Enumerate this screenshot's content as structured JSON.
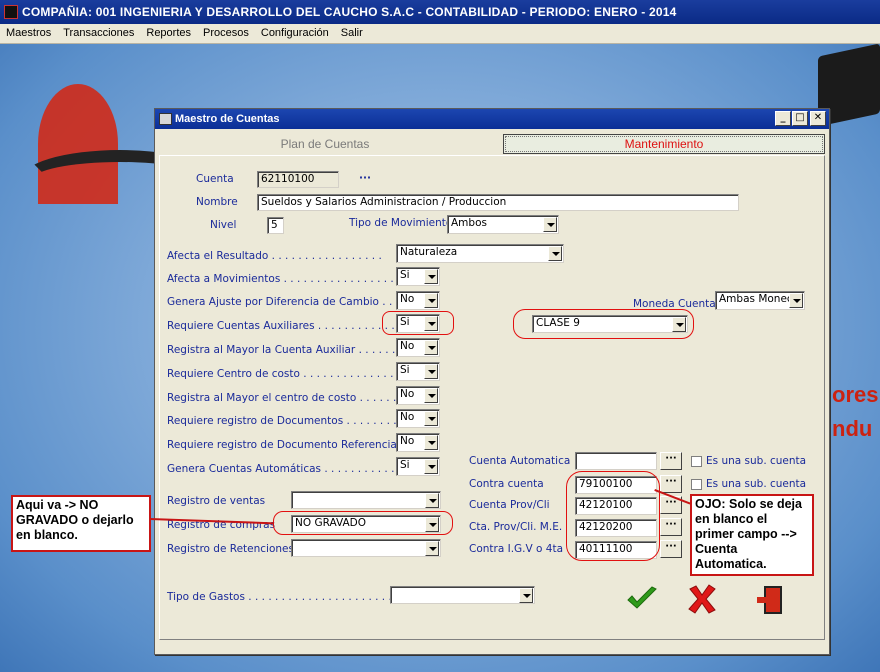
{
  "app": {
    "title": "COMPAÑIA:  001 INGENIERIA Y DESARROLLO DEL CAUCHO S.A.C    -    CONTABILIDAD    -    PERIODO: ENERO - 2014",
    "menu": [
      "Maestros",
      "Transacciones",
      "Reportes",
      "Procesos",
      "Configuración",
      "Salir"
    ]
  },
  "background": {
    "text1": "ores",
    "text2": "ndu"
  },
  "dialog": {
    "title": "Maestro de Cuentas",
    "tabs": {
      "plan": "Plan de Cuentas",
      "mantenimiento": "Mantenimiento"
    },
    "cuenta": {
      "label": "Cuenta",
      "value": "62110100",
      "extra": "···"
    },
    "nombre": {
      "label": "Nombre",
      "value": "Sueldos y Salarios Administracion / Produccion"
    },
    "nivel": {
      "label": "Nivel",
      "value": "5"
    },
    "tipo_movimiento": {
      "label": "Tipo de Movimiento",
      "value": "Ambos"
    },
    "rows": [
      {
        "label": "Afecta el  Resultado . . . . . . . . . . . . . . . . .",
        "value": "Naturaleza"
      },
      {
        "label": "Afecta a Movimientos . . . . . . . . . . . . . . . . . .",
        "value": "Si"
      },
      {
        "label": "Genera Ajuste por Diferencia de Cambio . . . .",
        "value": "No"
      },
      {
        "label": "Requiere Cuentas Auxiliares . . . . . . . . . . . .",
        "value": "Si"
      },
      {
        "label": "Registra al Mayor la Cuenta Auxiliar . . . . . . .",
        "value": "No"
      },
      {
        "label": "Requiere Centro de costo . . . . . . . . . . . . . .",
        "value": "Si"
      },
      {
        "label": "Registra al Mayor el centro de costo . . . . . . .",
        "value": "No"
      },
      {
        "label": "Requiere registro de Documentos . . . . . . . .",
        "value": "No"
      },
      {
        "label": "Requiere registro de Documento Referencia . .",
        "value": "No"
      },
      {
        "label": "Genera Cuentas Automáticas . . . . . . . . . . . .",
        "value": "Si"
      }
    ],
    "moneda_cuenta": {
      "label": "Moneda Cuenta",
      "value": "Ambas Monec"
    },
    "clase": {
      "value": "CLASE 9"
    },
    "registros": [
      {
        "label": "Registro de ventas",
        "value": ""
      },
      {
        "label": "Registro de compras",
        "value": "NO GRAVADO"
      },
      {
        "label": "Registro de Retenciones",
        "value": ""
      }
    ],
    "cuentas": [
      {
        "label": "Cuenta Automatica",
        "value": ""
      },
      {
        "label": "Contra cuenta",
        "value": "79100100"
      },
      {
        "label": "Cuenta Prov/Cli",
        "value": "42120100"
      },
      {
        "label": "Cta. Prov/Cli. M.E.",
        "value": "42120200"
      },
      {
        "label": "Contra I.G.V o 4ta",
        "value": "40111100"
      }
    ],
    "dots_label": "···",
    "sub_cuenta_label": "Es una sub. cuenta",
    "tipo_gastos": {
      "label": "Tipo de Gastos . . . . . . . . . . . . . . . . . . . . . . . . . .",
      "value": ""
    }
  },
  "notes": {
    "left": "Aqui va -> NO GRAVADO  o dejarlo en blanco.",
    "right": "OJO: Solo se deja en blanco el primer campo --> Cuenta Automatica."
  },
  "colors": {
    "accent_red": "#c81515",
    "label_blue": "#1a2a9a",
    "title_blue": "#0b2f96",
    "ok_green": "#2f9a1a"
  }
}
